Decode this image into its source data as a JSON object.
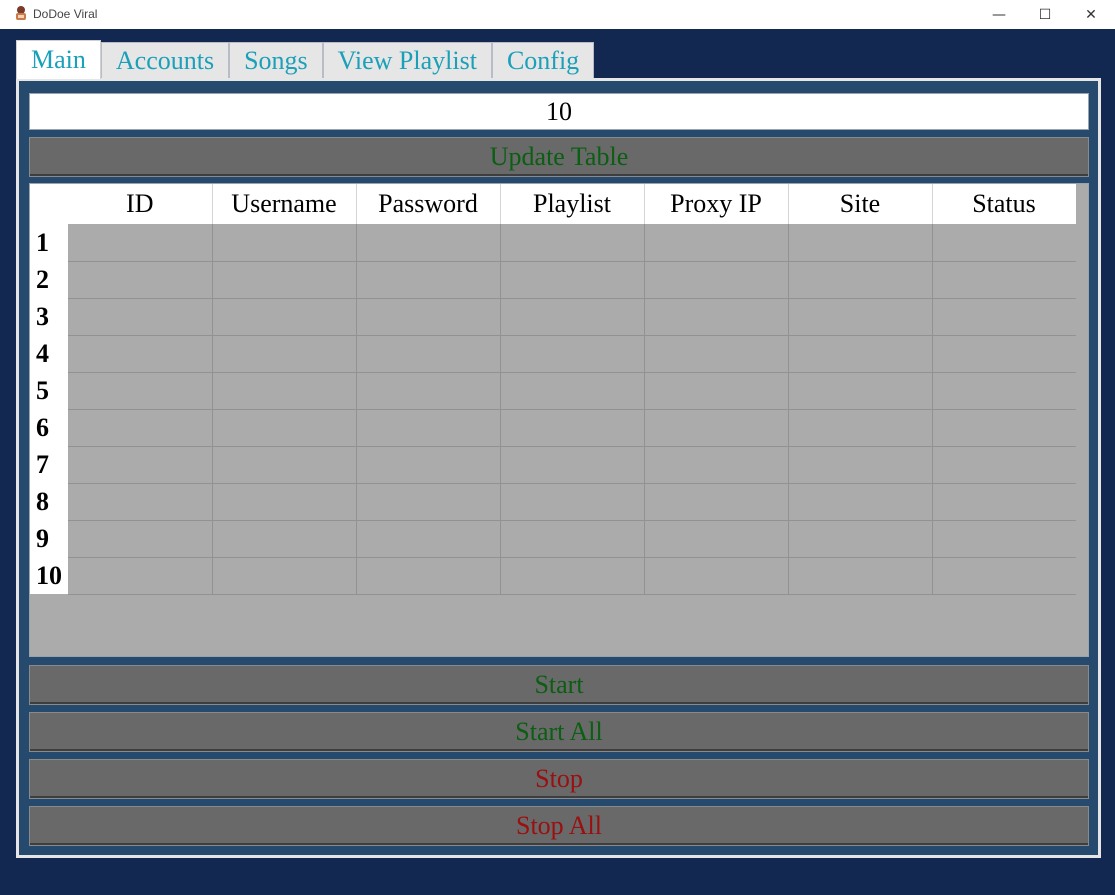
{
  "window": {
    "title": "DoDoe Viral",
    "minimize_glyph": "—",
    "maximize_glyph": "☐",
    "close_glyph": "✕"
  },
  "tabs": [
    {
      "label": "Main",
      "active": true
    },
    {
      "label": "Accounts",
      "active": false
    },
    {
      "label": "Songs",
      "active": false
    },
    {
      "label": "View Playlist",
      "active": false
    },
    {
      "label": "Config",
      "active": false
    }
  ],
  "main": {
    "rows_value": "10",
    "update_button": "Update Table",
    "table": {
      "columns": [
        "ID",
        "Username",
        "Password",
        "Playlist",
        "Proxy IP",
        "Site",
        "Status"
      ],
      "rows": [
        {
          "label": "1",
          "cells": [
            "",
            "",
            "",
            "",
            "",
            "",
            ""
          ]
        },
        {
          "label": "2",
          "cells": [
            "",
            "",
            "",
            "",
            "",
            "",
            ""
          ]
        },
        {
          "label": "3",
          "cells": [
            "",
            "",
            "",
            "",
            "",
            "",
            ""
          ]
        },
        {
          "label": "4",
          "cells": [
            "",
            "",
            "",
            "",
            "",
            "",
            ""
          ]
        },
        {
          "label": "5",
          "cells": [
            "",
            "",
            "",
            "",
            "",
            "",
            ""
          ]
        },
        {
          "label": "6",
          "cells": [
            "",
            "",
            "",
            "",
            "",
            "",
            ""
          ]
        },
        {
          "label": "7",
          "cells": [
            "",
            "",
            "",
            "",
            "",
            "",
            ""
          ]
        },
        {
          "label": "8",
          "cells": [
            "",
            "",
            "",
            "",
            "",
            "",
            ""
          ]
        },
        {
          "label": "9",
          "cells": [
            "",
            "",
            "",
            "",
            "",
            "",
            ""
          ]
        },
        {
          "label": "10",
          "cells": [
            "",
            "",
            "",
            "",
            "",
            "",
            ""
          ]
        }
      ]
    },
    "start_button": "Start",
    "start_all_button": "Start All",
    "stop_button": "Stop",
    "stop_all_button": "Stop All"
  },
  "colors": {
    "background": "#132850",
    "panel": "#264a6e",
    "button": "#696969",
    "go_text": "#0b5e12",
    "stop_text": "#9a0f0f",
    "tab_text": "#1aa0b8",
    "cell": "#ababab"
  },
  "icons": {
    "app": "app-logo-icon"
  }
}
